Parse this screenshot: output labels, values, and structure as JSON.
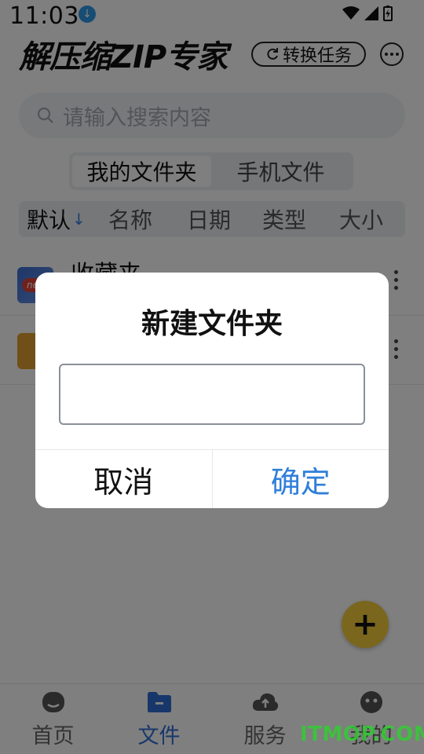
{
  "status": {
    "time": "11:03"
  },
  "header": {
    "logo_text": "解压缩ZIP专家",
    "convert_label": "转换任务"
  },
  "search": {
    "placeholder": "请输入搜索内容"
  },
  "tabs": [
    {
      "label": "我的文件夹",
      "active": true
    },
    {
      "label": "手机文件",
      "active": false
    }
  ],
  "sort": [
    {
      "label": "默认",
      "active": true
    },
    {
      "label": "名称"
    },
    {
      "label": "日期"
    },
    {
      "label": "类型"
    },
    {
      "label": "大小"
    }
  ],
  "files": [
    {
      "name": "收藏夹",
      "badge": "new"
    },
    {
      "name": ""
    }
  ],
  "nav": [
    {
      "label": "首页",
      "icon": "home-icon"
    },
    {
      "label": "文件",
      "icon": "folder-icon",
      "active": true
    },
    {
      "label": "服务",
      "icon": "cloud-upload-icon"
    },
    {
      "label": "我的",
      "icon": "user-face-icon"
    }
  ],
  "dialog": {
    "title": "新建文件夹",
    "input_value": "",
    "cancel_label": "取消",
    "confirm_label": "确定"
  },
  "watermark": "ITMOP.COM",
  "colors": {
    "accent": "#2f7fd9",
    "fab": "#f5cd3a",
    "badge": "#e0433a"
  }
}
